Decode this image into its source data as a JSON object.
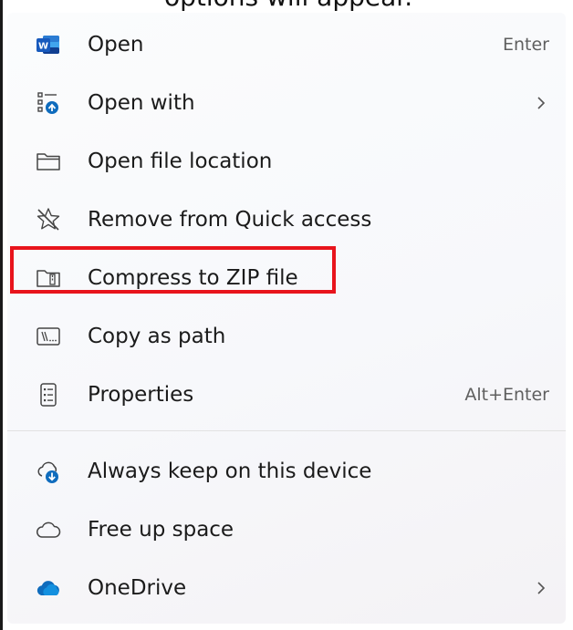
{
  "partial_top_text": "options will appear.",
  "menu": {
    "items": [
      {
        "label": "Open",
        "shortcut": "Enter",
        "icon": "word-document-icon"
      },
      {
        "label": "Open with",
        "icon": "open-with-icon",
        "submenu": true
      },
      {
        "label": "Open file location",
        "icon": "folder-icon"
      },
      {
        "label": "Remove from Quick access",
        "icon": "unpin-star-icon"
      },
      {
        "label": "Compress to ZIP file",
        "icon": "zip-folder-icon"
      },
      {
        "label": "Copy as path",
        "icon": "copy-path-icon"
      },
      {
        "label": "Properties",
        "shortcut": "Alt+Enter",
        "icon": "properties-icon"
      },
      {
        "label": "Always keep on this device",
        "icon": "cloud-download-icon"
      },
      {
        "label": "Free up space",
        "icon": "cloud-outline-icon"
      },
      {
        "label": "OneDrive",
        "icon": "onedrive-icon",
        "submenu": true
      }
    ]
  },
  "colors": {
    "highlight": "#e8141c",
    "accent_blue": "#0f6cbd",
    "word_blue": "#185abd"
  }
}
